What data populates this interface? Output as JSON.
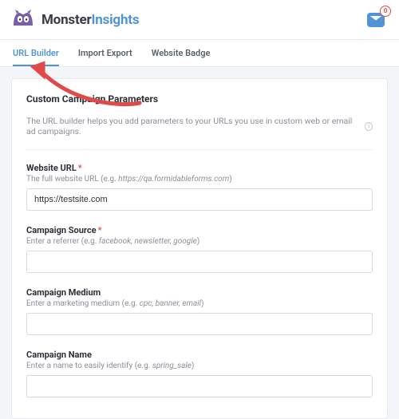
{
  "brand": {
    "first": "Monster",
    "second": "Insights"
  },
  "inbox": {
    "badge": "0"
  },
  "tabs": [
    {
      "label": "URL Builder",
      "active": true
    },
    {
      "label": "Import Export",
      "active": false
    },
    {
      "label": "Website Badge",
      "active": false
    }
  ],
  "card": {
    "title": "Custom Campaign Parameters",
    "description": "The URL builder helps you add parameters to your URLs you use in custom web or email ad campaigns."
  },
  "fields": {
    "url": {
      "label": "Website URL",
      "required": true,
      "hint_prefix": "The full website URL (e.g. ",
      "hint_em": "https://qa.formidableforms.com",
      "hint_suffix": ")",
      "value": "https://testsite.com"
    },
    "source": {
      "label": "Campaign Source",
      "required": true,
      "hint_prefix": "Enter a referrer (e.g. ",
      "hint_em": "facebook, newsletter, google",
      "hint_suffix": ")",
      "value": ""
    },
    "medium": {
      "label": "Campaign Medium",
      "required": false,
      "hint_prefix": "Enter a marketing medium (e.g. ",
      "hint_em": "cpc, banner, email",
      "hint_suffix": ")",
      "value": ""
    },
    "name": {
      "label": "Campaign Name",
      "required": false,
      "hint_prefix": "Enter a name to easily identify (e.g. ",
      "hint_em": "spring_sale",
      "hint_suffix": ")",
      "value": ""
    }
  },
  "colors": {
    "accent": "#4f94d4",
    "arrow": "#e24a4a"
  }
}
